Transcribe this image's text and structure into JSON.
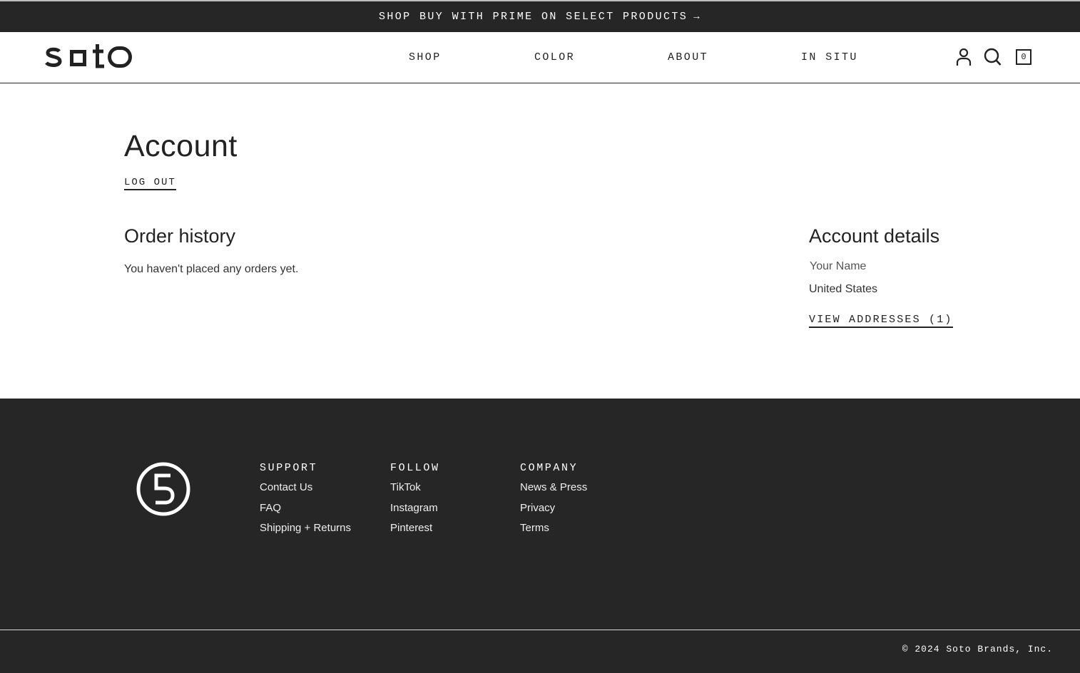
{
  "announcement": {
    "text": "SHOP BUY WITH PRIME ON SELECT PRODUCTS",
    "arrow": "→"
  },
  "header": {
    "logo_text": "soto",
    "nav": [
      "SHOP",
      "COLOR",
      "ABOUT",
      "IN SITU"
    ],
    "cart_count": "0",
    "icons": [
      "account-icon",
      "search-icon",
      "cart-icon"
    ]
  },
  "account": {
    "title": "Account",
    "logout_label": "LOG OUT",
    "order_history": {
      "heading": "Order history",
      "empty_message": "You haven't placed any orders yet."
    },
    "details": {
      "heading": "Account details",
      "name": "Your Name",
      "country": "United States",
      "view_addresses_label": "VIEW ADDRESSES (1)"
    }
  },
  "footer": {
    "logo_icon": "soto-monogram-icon",
    "columns": [
      {
        "heading": "SUPPORT",
        "links": [
          "Contact Us",
          "FAQ",
          "Shipping + Returns"
        ]
      },
      {
        "heading": "FOLLOW",
        "links": [
          "TikTok",
          "Instagram",
          "Pinterest"
        ]
      },
      {
        "heading": "COMPANY",
        "links": [
          "News & Press",
          "Privacy",
          "Terms"
        ]
      }
    ],
    "copyright": "© 2024 Soto Brands, Inc."
  },
  "colors": {
    "dark": "#262626",
    "text": "#222222",
    "background": "#ffffff",
    "footer_text": "#ffffff"
  }
}
